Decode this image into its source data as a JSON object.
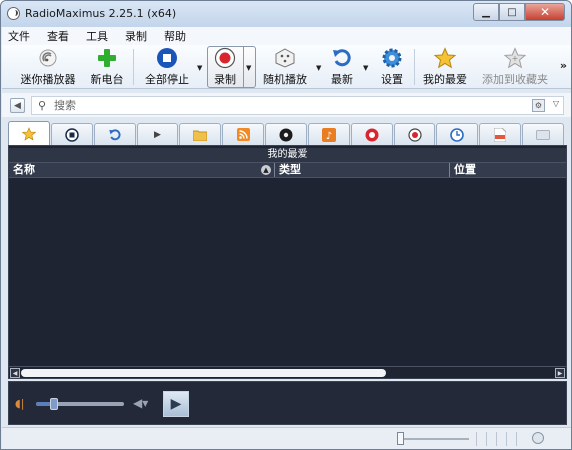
{
  "window": {
    "title": "RadioMaximus 2.25.1 (x64)",
    "minimize_symbol": "▁",
    "maximize_symbol": "□",
    "close_symbol": "✕"
  },
  "menu": [
    "文件",
    "查看",
    "工具",
    "录制",
    "帮助"
  ],
  "toolbar": {
    "mini_player": "迷你播放器",
    "new_station": "新电台",
    "stop_all": "全部停止",
    "record": "录制",
    "random_play": "随机播放",
    "latest": "最新",
    "settings": "设置",
    "favorites": "我的最爱",
    "add_to_favorites": "添加到收藏夹",
    "more": "»"
  },
  "search": {
    "placeholder": "搜索",
    "value": ""
  },
  "tabs": [
    {
      "icon": "star-icon",
      "active": true
    },
    {
      "icon": "stop-square-icon"
    },
    {
      "icon": "undo-arrow-icon"
    },
    {
      "icon": "play-small-icon"
    },
    {
      "icon": "folder-icon"
    },
    {
      "icon": "rss-icon"
    },
    {
      "icon": "radio-disc-icon"
    },
    {
      "icon": "music-note-icon"
    },
    {
      "icon": "record-red-icon"
    },
    {
      "icon": "record-target-icon"
    },
    {
      "icon": "clock-icon"
    },
    {
      "icon": "pdf-icon"
    },
    {
      "icon": "blank-tab-icon"
    }
  ],
  "list": {
    "section_title": "我的最爱",
    "columns": [
      "名称",
      "类型",
      "位置"
    ]
  },
  "player": {
    "volume_level": 0.2
  },
  "colors": {
    "panel_bg": "#1f2433",
    "title_bar": "#c3d5eb",
    "accent_blue": "#2b6cc4",
    "stop_blue": "#1a56b8",
    "add_green": "#2fae2f",
    "record_red": "#d7262e",
    "star_gold": "#e8b21c"
  }
}
